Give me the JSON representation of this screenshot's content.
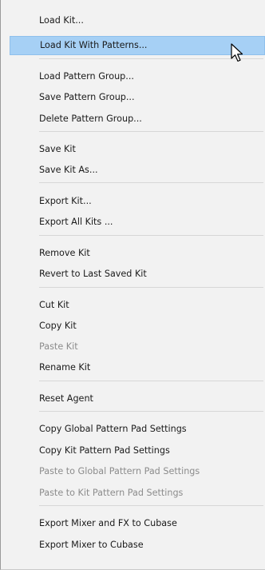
{
  "menu": {
    "items": [
      {
        "label": "Load Kit..."
      },
      {
        "label": "Load Kit With Patterns..."
      },
      {
        "label": "Load Pattern Group..."
      },
      {
        "label": "Save Pattern Group..."
      },
      {
        "label": "Delete Pattern Group..."
      },
      {
        "label": "Save Kit"
      },
      {
        "label": "Save Kit As..."
      },
      {
        "label": "Export Kit..."
      },
      {
        "label": "Export All Kits ..."
      },
      {
        "label": "Remove Kit"
      },
      {
        "label": "Revert to Last Saved Kit"
      },
      {
        "label": "Cut Kit"
      },
      {
        "label": "Copy Kit"
      },
      {
        "label": "Paste Kit"
      },
      {
        "label": "Rename Kit"
      },
      {
        "label": "Reset Agent"
      },
      {
        "label": "Copy Global Pattern Pad Settings"
      },
      {
        "label": "Copy Kit Pattern Pad Settings"
      },
      {
        "label": "Paste to Global Pattern Pad Settings"
      },
      {
        "label": "Paste to Kit Pattern Pad Settings"
      },
      {
        "label": "Export Mixer and FX to Cubase"
      },
      {
        "label": "Export Mixer to Cubase"
      }
    ]
  },
  "colors": {
    "highlight": "#a6d0f5",
    "disabled_text": "#8c8c8c"
  },
  "cursor": {
    "icon": "mouse-pointer-icon"
  }
}
